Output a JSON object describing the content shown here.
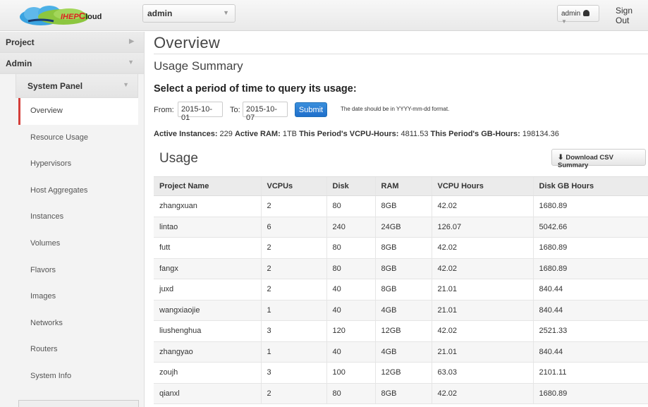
{
  "brand": {
    "name_prefix": "IHEP",
    "name_c": "C",
    "name_suffix": "loud"
  },
  "header": {
    "project": "admin",
    "user": "admin",
    "signout": "Sign Out"
  },
  "sidebar": {
    "dash_project": "Project",
    "dash_admin": "Admin",
    "panel": "System Panel",
    "items": [
      "Overview",
      "Resource Usage",
      "Hypervisors",
      "Host Aggregates",
      "Instances",
      "Volumes",
      "Flavors",
      "Images",
      "Networks",
      "Routers",
      "System Info"
    ]
  },
  "main": {
    "page_title": "Overview",
    "summary_title": "Usage Summary",
    "period_title": "Select a period of time to query its usage:",
    "form": {
      "from_label": "From:",
      "from_value": "2015-10-01",
      "to_label": "To:",
      "to_value": "2015-10-07",
      "submit": "Submit",
      "hint": "The date should be in YYYY-mm-dd format."
    },
    "stats": {
      "instances_label": "Active Instances:",
      "instances_value": "229",
      "ram_label": "Active RAM:",
      "ram_value": "1TB",
      "vcpu_label": "This Period's VCPU-Hours:",
      "vcpu_value": "4811.53",
      "gb_label": "This Period's GB-Hours:",
      "gb_value": "198134.36"
    },
    "usage_title": "Usage",
    "csv_button": "Download CSV Summary",
    "table": {
      "headers": [
        "Project Name",
        "VCPUs",
        "Disk",
        "RAM",
        "VCPU Hours",
        "Disk GB Hours"
      ],
      "rows": [
        [
          "zhangxuan",
          "2",
          "80",
          "8GB",
          "42.02",
          "1680.89"
        ],
        [
          "lintao",
          "6",
          "240",
          "24GB",
          "126.07",
          "5042.66"
        ],
        [
          "futt",
          "2",
          "80",
          "8GB",
          "42.02",
          "1680.89"
        ],
        [
          "fangx",
          "2",
          "80",
          "8GB",
          "42.02",
          "1680.89"
        ],
        [
          "juxd",
          "2",
          "40",
          "8GB",
          "21.01",
          "840.44"
        ],
        [
          "wangxiaojie",
          "1",
          "40",
          "4GB",
          "21.01",
          "840.44"
        ],
        [
          "liushenghua",
          "3",
          "120",
          "12GB",
          "42.02",
          "2521.33"
        ],
        [
          "zhangyao",
          "1",
          "40",
          "4GB",
          "21.01",
          "840.44"
        ],
        [
          "zoujh",
          "3",
          "100",
          "12GB",
          "63.03",
          "2101.11"
        ],
        [
          "qianxl",
          "2",
          "80",
          "8GB",
          "42.02",
          "1680.89"
        ]
      ]
    }
  },
  "colors": {
    "accent": "#d43f3a",
    "primary": "#2a7fd4"
  }
}
